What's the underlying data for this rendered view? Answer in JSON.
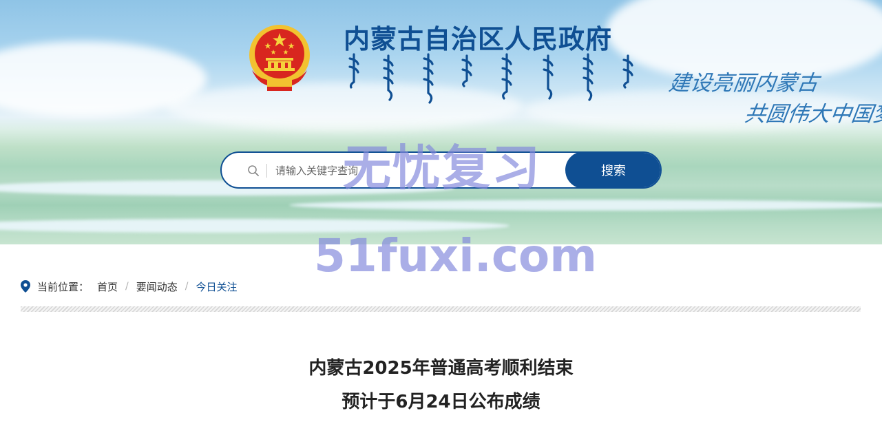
{
  "banner": {
    "site_title": "内蒙古自治区人民政府",
    "slogan_line1": "建设亮丽内蒙古",
    "slogan_line2": "共圆伟大中国梦"
  },
  "search": {
    "placeholder": "请输入关键字查询",
    "button_label": "搜索"
  },
  "breadcrumb": {
    "label": "当前位置：",
    "items": [
      "首页",
      "要闻动态",
      "今日关注"
    ],
    "separator": "/"
  },
  "article": {
    "title_line1": "内蒙古2025年普通高考顺利结束",
    "title_line2": "预计于6月24日公布成绩"
  },
  "watermark": {
    "line1": "无忧复习",
    "line2": "51fuxi.com"
  },
  "colors": {
    "brand_blue": "#0f4f93",
    "slogan_blue": "#2f78b7",
    "emblem_red": "#d8261f",
    "emblem_gold": "#f2c230",
    "watermark": "#8287dc"
  },
  "icons": {
    "search": "search-icon",
    "location": "location-pin-icon",
    "emblem": "national-emblem-logo"
  }
}
